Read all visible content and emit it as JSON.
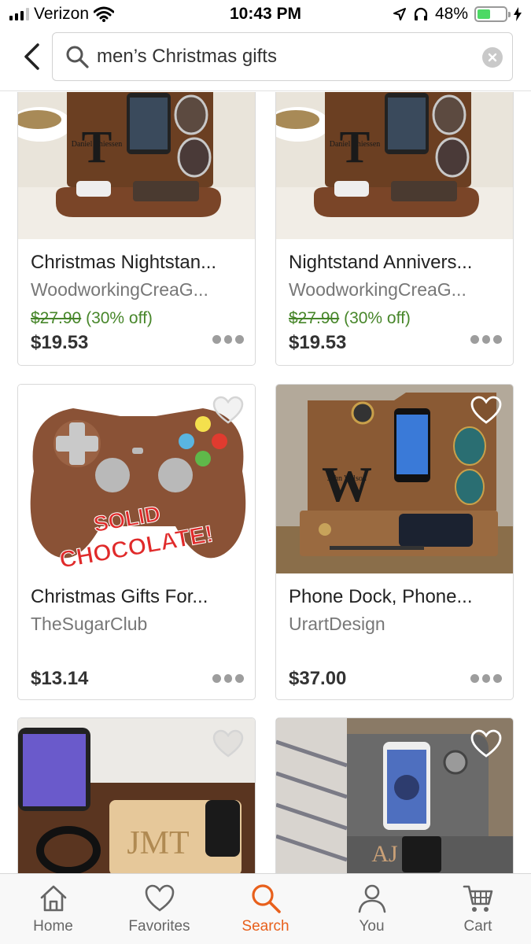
{
  "status_bar": {
    "carrier": "Verizon",
    "time": "10:43 PM",
    "battery_percent": "48%",
    "battery_level": 0.48,
    "icons": [
      "signal-icon",
      "wifi-icon",
      "location-icon",
      "headphones-icon",
      "battery-icon",
      "charging-icon"
    ]
  },
  "search": {
    "query": "men’s Christmas gifts",
    "icons": [
      "back-chevron-icon",
      "search-icon",
      "clear-icon"
    ]
  },
  "colors": {
    "accent": "#e8601c",
    "sale_green": "#47862a",
    "border": "#d9d9d9"
  },
  "listings": [
    {
      "title": "Christmas Nightstan...",
      "shop": "WoodworkingCreaG...",
      "original_price": "$27.90",
      "discount": "(30% off)",
      "price": "$19.53",
      "image_text": "Daniel Thiessen",
      "image_letter": "T"
    },
    {
      "title": "Nightstand Annivers...",
      "shop": "WoodworkingCreaG...",
      "original_price": "$27.90",
      "discount": "(30% off)",
      "price": "$19.53",
      "image_text": "Daniel Thiessen",
      "image_letter": "T"
    },
    {
      "title": "Christmas Gifts For...",
      "shop": "TheSugarClub",
      "price": "$13.14",
      "image_text_1": "SOLID",
      "image_text_2": "CHOCOLATE!"
    },
    {
      "title": "Phone Dock, Phone...",
      "shop": "UrartDesign",
      "price": "$37.00",
      "image_text": "John Wilson",
      "image_letter": "W"
    },
    {
      "image_text": "JMT"
    },
    {
      "image_text": "AJ"
    }
  ],
  "tab_bar": [
    {
      "label": "Home",
      "icon": "home-icon",
      "active": false
    },
    {
      "label": "Favorites",
      "icon": "heart-icon",
      "active": false
    },
    {
      "label": "Search",
      "icon": "search-icon",
      "active": true
    },
    {
      "label": "You",
      "icon": "person-icon",
      "active": false
    },
    {
      "label": "Cart",
      "icon": "cart-icon",
      "active": false
    }
  ]
}
